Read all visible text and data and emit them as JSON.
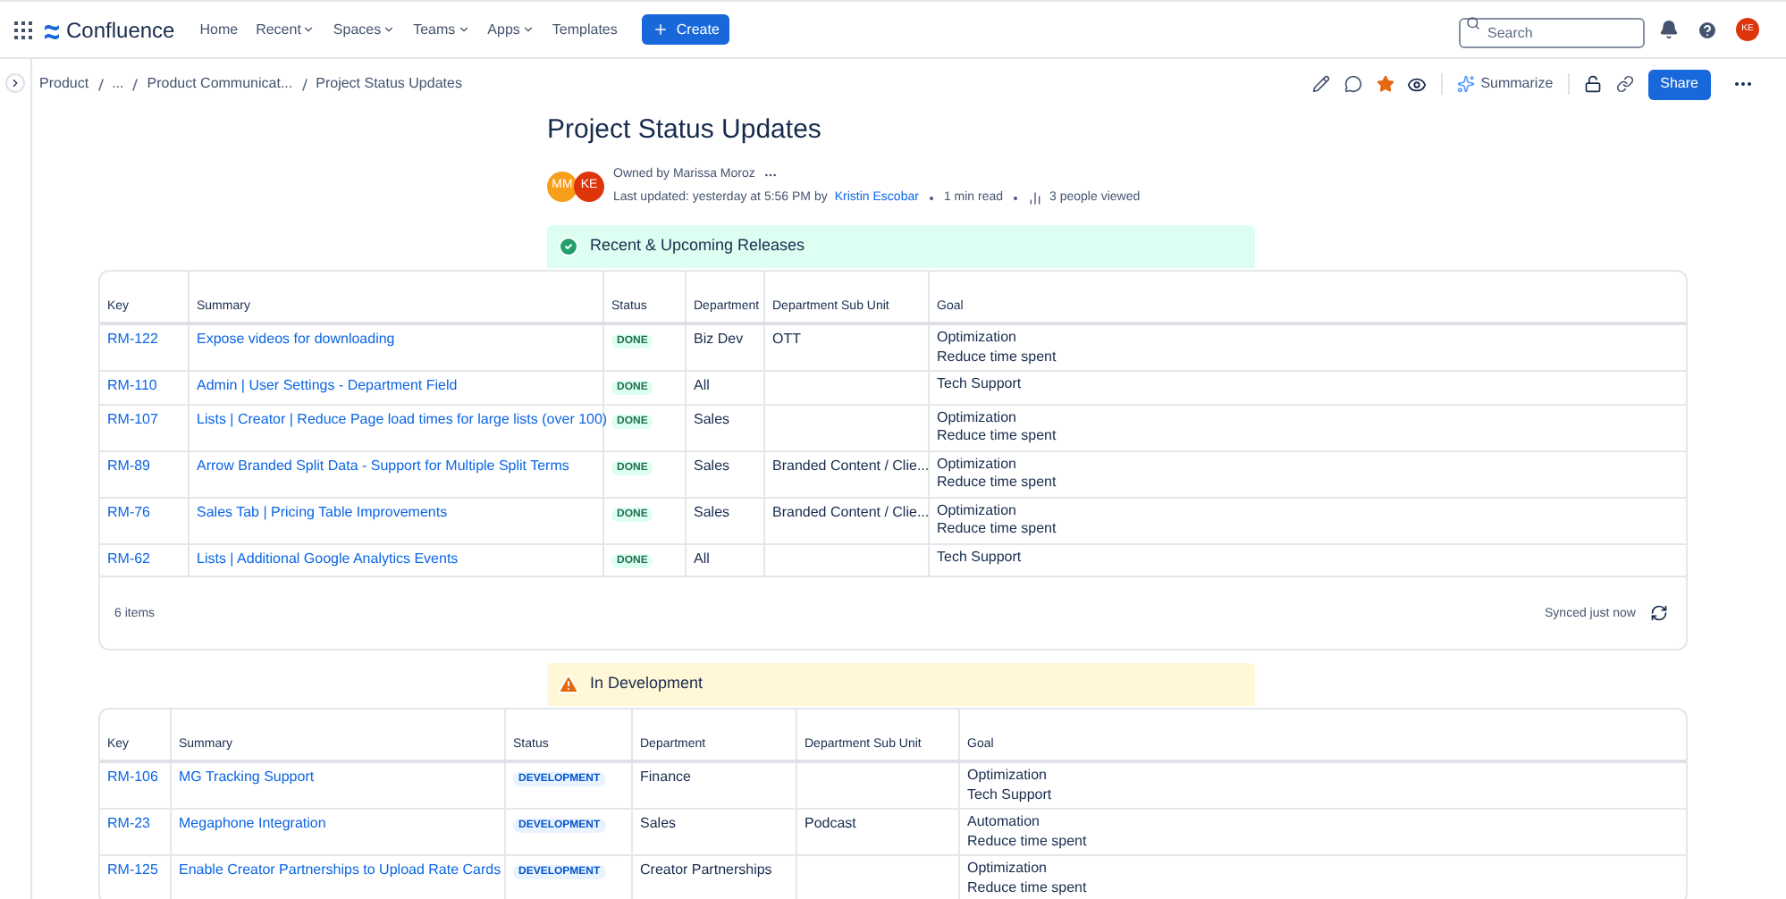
{
  "top_nav": {
    "product": "Confluence",
    "items": [
      {
        "label": "Home",
        "dropdown": false
      },
      {
        "label": "Recent",
        "dropdown": true
      },
      {
        "label": "Spaces",
        "dropdown": true
      },
      {
        "label": "Teams",
        "dropdown": true
      },
      {
        "label": "Apps",
        "dropdown": true
      },
      {
        "label": "Templates",
        "dropdown": false
      }
    ],
    "create": "Create",
    "search": {
      "placeholder": "Search"
    },
    "user_avatar": "KE"
  },
  "breadcrumbs": [
    "Product",
    "...",
    "Product Communicat...",
    "Project Status Updates"
  ],
  "page_toolbar": {
    "starred": true,
    "summarize": "Summarize",
    "share": "Share"
  },
  "page": {
    "title": "Project Status Updates",
    "avatars": [
      {
        "initials": "MM",
        "color": "#f79e1b"
      },
      {
        "initials": "KE",
        "color": "#de350b"
      }
    ],
    "owner": "Owned by Marissa Moroz",
    "updated": "Last updated: yesterday at 5:56 PM by",
    "author": "Kristin Escobar",
    "read_time": "1 min read",
    "views": "3 people viewed"
  },
  "sections": [
    {
      "panel": {
        "kind": "success",
        "text": "Recent & Upcoming Releases"
      },
      "table": {
        "columns": [
          "Key",
          "Summary",
          "Status",
          "Department",
          "Department Sub Unit",
          "Goal"
        ],
        "rows": [
          {
            "key": "RM-122",
            "summary": "Expose videos for downloading",
            "status": {
              "text": "DONE",
              "kind": "done"
            },
            "department": "Biz Dev",
            "sub_unit": "OTT",
            "goal": [
              "Optimization",
              "Reduce time spent"
            ]
          },
          {
            "key": "RM-110",
            "summary": "Admin | User Settings - Department Field",
            "status": {
              "text": "DONE",
              "kind": "done"
            },
            "department": "All",
            "sub_unit": "",
            "goal": [
              "Tech Support"
            ]
          },
          {
            "key": "RM-107",
            "summary": "Lists | Creator | Reduce Page load times for large lists (over 100)",
            "status": {
              "text": "DONE",
              "kind": "done"
            },
            "department": "Sales",
            "sub_unit": "",
            "goal": [
              "Optimization",
              "Reduce time spent"
            ]
          },
          {
            "key": "RM-89",
            "summary": "Arrow Branded Split Data - Support for Multiple Split Terms",
            "status": {
              "text": "DONE",
              "kind": "done"
            },
            "department": "Sales",
            "sub_unit": "Branded Content / Clie...",
            "goal": [
              "Optimization",
              "Reduce time spent"
            ]
          },
          {
            "key": "RM-76",
            "summary": "Sales Tab | Pricing Table Improvements",
            "status": {
              "text": "DONE",
              "kind": "done"
            },
            "department": "Sales",
            "sub_unit": "Branded Content / Clie...",
            "goal": [
              "Optimization",
              "Reduce time spent"
            ]
          },
          {
            "key": "RM-62",
            "summary": "Lists | Additional Google Analytics Events",
            "status": {
              "text": "DONE",
              "kind": "done"
            },
            "department": "All",
            "sub_unit": "",
            "goal": [
              "Tech Support"
            ]
          }
        ],
        "footer": {
          "count": "6 items",
          "synced": "Synced just now"
        }
      }
    },
    {
      "panel": {
        "kind": "warning",
        "text": "In Development"
      },
      "table": {
        "columns": [
          "Key",
          "Summary",
          "Status",
          "Department",
          "Department Sub Unit",
          "Goal"
        ],
        "rows": [
          {
            "key": "RM-106",
            "summary": "MG Tracking Support",
            "status": {
              "text": "DEVELOPMENT",
              "kind": "development"
            },
            "department": "Finance",
            "sub_unit": "",
            "goal": [
              "Optimization",
              "Tech Support"
            ]
          },
          {
            "key": "RM-23",
            "summary": "Megaphone Integration",
            "status": {
              "text": "DEVELOPMENT",
              "kind": "development"
            },
            "department": "Sales",
            "sub_unit": "Podcast",
            "goal": [
              "Automation",
              "Reduce time spent"
            ]
          },
          {
            "key": "RM-125",
            "summary": "Enable Creator Partnerships to Upload Rate Cards",
            "status": {
              "text": "DEVELOPMENT",
              "kind": "development"
            },
            "department": "Creator Partnerships",
            "sub_unit": "",
            "goal": [
              "Optimization",
              "Reduce time spent"
            ]
          }
        ]
      }
    }
  ]
}
